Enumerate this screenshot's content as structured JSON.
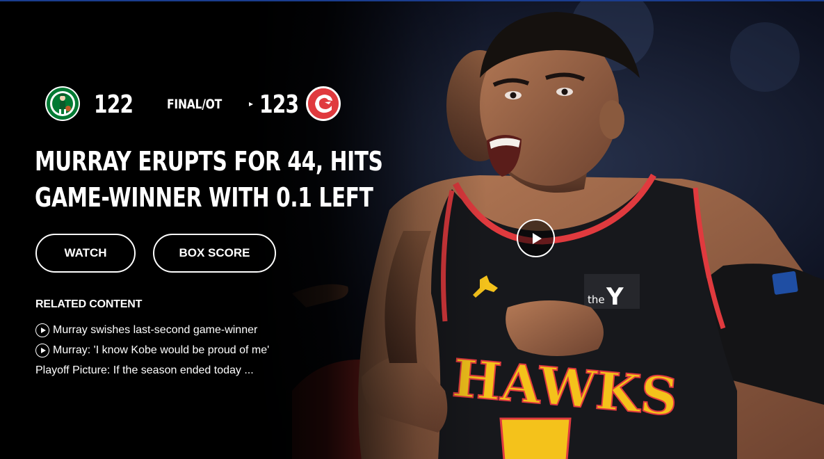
{
  "game": {
    "away": {
      "team_icon": "celtics-logo",
      "score": "122"
    },
    "home": {
      "team_icon": "hawks-logo",
      "score": "123"
    },
    "status": "FINAL/OT",
    "winner_marker": "▸"
  },
  "headline": {
    "line1": "MURRAY ERUPTS FOR 44, HITS",
    "line2": "GAME-WINNER WITH 0.1 LEFT"
  },
  "buttons": {
    "watch_label": "WATCH",
    "box_score_label": "BOX SCORE"
  },
  "related": {
    "title": "RELATED CONTENT",
    "items": [
      {
        "icon": "play-circle-icon",
        "label": "Murray swishes last-second game-winner"
      },
      {
        "icon": "play-circle-icon",
        "label": "Murray: 'I know Kobe would be proud of me'"
      },
      {
        "icon": "",
        "label": "Playoff Picture: If the season ended today ..."
      }
    ]
  },
  "jersey_text": "HAWKS",
  "colors": {
    "hawks_red": "#e03a3e",
    "jersey_black": "#17181c",
    "jersey_yellow": "#f4c21b",
    "celtics_green": "#007a33",
    "top_border": "#1a3d8f"
  }
}
